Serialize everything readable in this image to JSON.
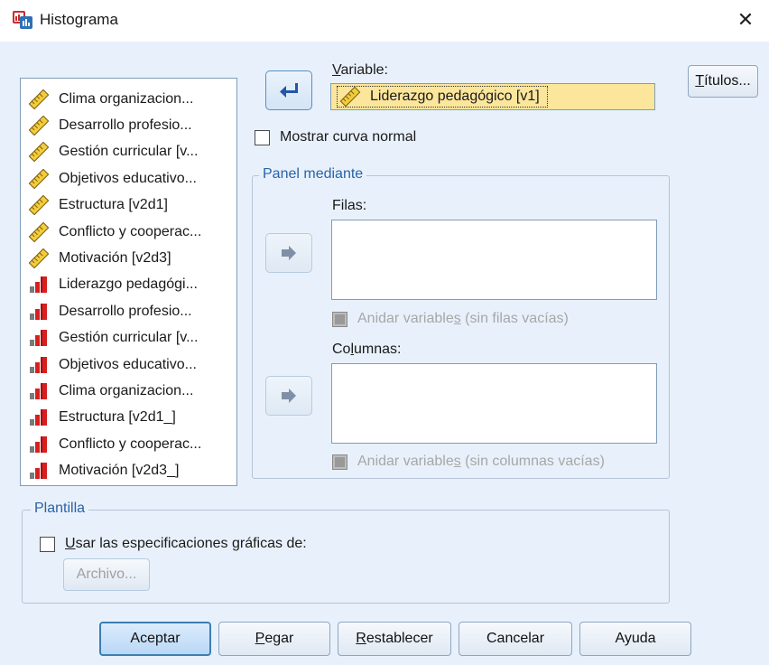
{
  "window": {
    "title": "Histograma",
    "close_glyph": "✕"
  },
  "variables": [
    {
      "label": "Clima organizacion...",
      "type": "scale"
    },
    {
      "label": "Desarrollo profesio...",
      "type": "scale"
    },
    {
      "label": "Gestión curricular [v...",
      "type": "scale"
    },
    {
      "label": "Objetivos educativo...",
      "type": "scale"
    },
    {
      "label": "Estructura [v2d1]",
      "type": "scale"
    },
    {
      "label": "Conflicto y cooperac...",
      "type": "scale"
    },
    {
      "label": "Motivación [v2d3]",
      "type": "scale"
    },
    {
      "label": "Liderazgo pedagógi...",
      "type": "ordinal"
    },
    {
      "label": "Desarrollo profesio...",
      "type": "ordinal"
    },
    {
      "label": "Gestión curricular [v...",
      "type": "ordinal"
    },
    {
      "label": "Objetivos educativo...",
      "type": "ordinal"
    },
    {
      "label": "Clima organizacion...",
      "type": "ordinal"
    },
    {
      "label": "Estructura [v2d1_]",
      "type": "ordinal"
    },
    {
      "label": "Conflicto y cooperac...",
      "type": "ordinal"
    },
    {
      "label": "Motivación [v2d3_]",
      "type": "ordinal"
    }
  ],
  "variable_field": {
    "label_u": "V",
    "label_rest": "ariable:",
    "value": "Liderazgo pedagógico [v1]",
    "type": "scale"
  },
  "normal_curve": {
    "label": "Mostrar curva normal",
    "checked": false
  },
  "panel": {
    "legend": "Panel mediante",
    "rows_label": "Filas:",
    "rows_nest_pre": "Anidar variable",
    "rows_nest_u": "s",
    "rows_nest_post": " (sin filas vacías)",
    "cols_label_pre": "Co",
    "cols_label_u": "l",
    "cols_label_post": "umnas:",
    "cols_nest_pre": "Anidar variable",
    "cols_nest_u": "s",
    "cols_nest_post": " (sin columnas vacías)"
  },
  "template": {
    "legend": "Plantilla",
    "use_u": "U",
    "use_rest": "sar las especificaciones gráficas de:",
    "file_button": "Archivo..."
  },
  "titles_button": {
    "u": "T",
    "rest": "ítulos..."
  },
  "buttons": {
    "ok": "Aceptar",
    "paste_u": "P",
    "paste_rest": "egar",
    "reset_u": "R",
    "reset_rest": "establecer",
    "cancel": "Cancelar",
    "help": "Ayuda"
  },
  "colors": {
    "background": "#e8f1fb",
    "selected_field": "#fbe69b",
    "accent": "#2a62a8"
  }
}
